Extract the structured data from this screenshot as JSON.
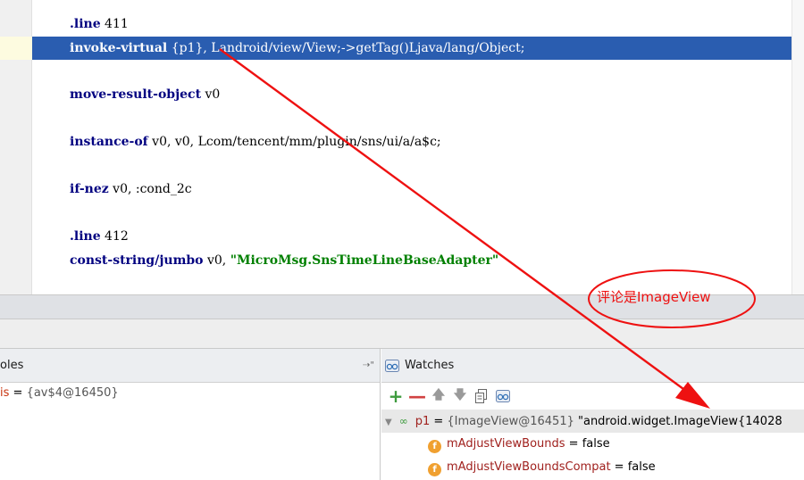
{
  "editor": {
    "lines": [
      {
        "keyword": ".line",
        "rest": " 411"
      },
      {
        "keyword": "invoke-virtual",
        "rest": " {p1}, Landroid/view/View;->getTag()Ljava/lang/Object;"
      },
      {
        "keyword": "move-result-object",
        "rest": " v0"
      },
      {
        "keyword": "instance-of",
        "rest": " v0, v0, Lcom/tencent/mm/plugin/sns/ui/a/a$c;"
      },
      {
        "keyword": "if-nez",
        "rest": " v0, :cond_2c"
      },
      {
        "keyword": ".line",
        "rest": " 412"
      },
      {
        "keyword": "const-string/jumbo",
        "rest": " v0, ",
        "string": "\"MicroMsg.SnsTimeLineBaseAdapter\""
      }
    ]
  },
  "variables": {
    "title": "oles",
    "rows": [
      {
        "name": "is",
        "eq": " = ",
        "value": "{av$4@16450}"
      }
    ]
  },
  "watches": {
    "title": "Watches",
    "tools": {
      "add": "+",
      "remove": "—",
      "up": "🡅",
      "down": "🡇"
    },
    "root": {
      "name": "p1",
      "eq": " = ",
      "value": "{ImageView@16451} ",
      "string": "\"android.widget.ImageView{14028"
    },
    "fields": [
      {
        "badge": "f",
        "name": "mAdjustViewBounds",
        "eq": " = ",
        "value": "false"
      },
      {
        "badge": "f",
        "name": "mAdjustViewBoundsCompat",
        "eq": " = ",
        "value": "false"
      }
    ]
  },
  "annotation": {
    "note": "评论是ImageView",
    "color": "#ee1111"
  },
  "colors": {
    "selection": "#2a5db0",
    "keyword": "#000080",
    "string": "#008000"
  }
}
